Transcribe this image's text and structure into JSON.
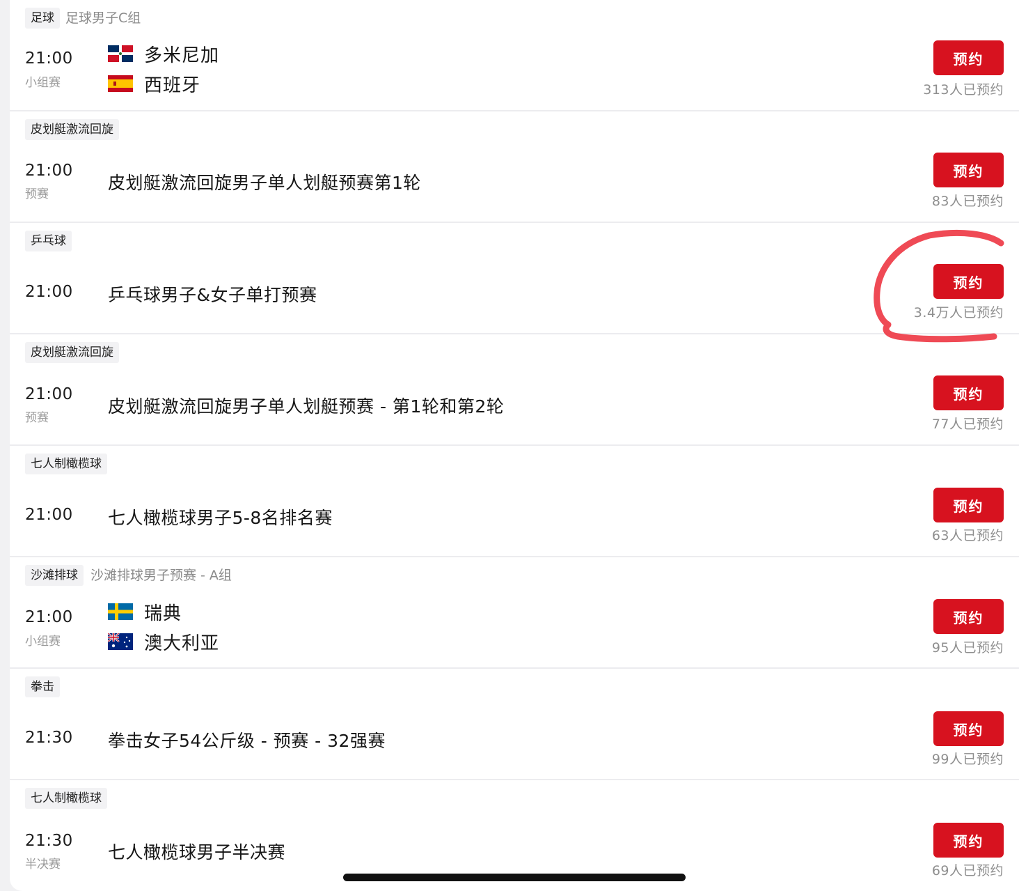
{
  "events": [
    {
      "tag": "足球",
      "subtag": "足球男子C组",
      "time": "21:00",
      "stage": "小组赛",
      "teams": [
        {
          "name": "多米尼加",
          "flag": "dominican-flag-icon"
        },
        {
          "name": "西班牙",
          "flag": "spain-flag-icon"
        }
      ],
      "button": "预约",
      "count": "313人已预约"
    },
    {
      "tag": "皮划艇激流回旋",
      "time": "21:00",
      "stage": "预赛",
      "title": "皮划艇激流回旋男子单人划艇预赛第1轮",
      "button": "预约",
      "count": "83人已预约"
    },
    {
      "tag": "乒乓球",
      "time": "21:00",
      "title": "乒乓球男子&女子单打预赛",
      "button": "预约",
      "count": "3.4万人已预约"
    },
    {
      "tag": "皮划艇激流回旋",
      "time": "21:00",
      "stage": "预赛",
      "title": "皮划艇激流回旋男子单人划艇预赛 - 第1轮和第2轮",
      "button": "预约",
      "count": "77人已预约"
    },
    {
      "tag": "七人制橄榄球",
      "time": "21:00",
      "title": "七人橄榄球男子5-8名排名赛",
      "button": "预约",
      "count": "63人已预约"
    },
    {
      "tag": "沙滩排球",
      "subtag": "沙滩排球男子预赛 - A组",
      "time": "21:00",
      "stage": "小组赛",
      "teams": [
        {
          "name": "瑞典",
          "flag": "sweden-flag-icon"
        },
        {
          "name": "澳大利亚",
          "flag": "australia-flag-icon"
        }
      ],
      "button": "预约",
      "count": "95人已预约"
    },
    {
      "tag": "拳击",
      "time": "21:30",
      "title": "拳击女子54公斤级 - 预赛 - 32强赛",
      "button": "预约",
      "count": "99人已预约"
    },
    {
      "tag": "七人制橄榄球",
      "time": "21:30",
      "stage": "半决赛",
      "title": "七人橄榄球男子半决赛",
      "button": "预约",
      "count": "69人已预约"
    }
  ],
  "colors": {
    "accent": "#d7121f",
    "annotation": "#ee3b46"
  }
}
